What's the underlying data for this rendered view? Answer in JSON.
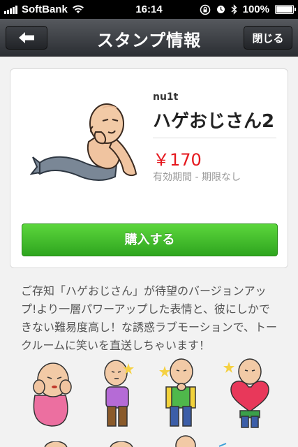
{
  "status_bar": {
    "carrier": "SoftBank",
    "time": "16:14",
    "battery": "100%"
  },
  "nav": {
    "title": "スタンプ情報",
    "close_label": "閉じる"
  },
  "product": {
    "author": "nu1t",
    "title": "ハゲおじさん2",
    "price": "￥170",
    "period": "有効期間 - 期限なし",
    "buy_label": "購入する"
  },
  "description": "ご存知「ハゲおじさん」が待望のバージョンアップ!より一層パワーアップした表情と、彼にしかできない難易度高し！な誘惑ラブモーションで、トークルームに笑いを直送しちゃいます！",
  "colors": {
    "price": "#e5171d",
    "buy_button": "#3cbf25",
    "nav_bar": "#3a3d42"
  }
}
